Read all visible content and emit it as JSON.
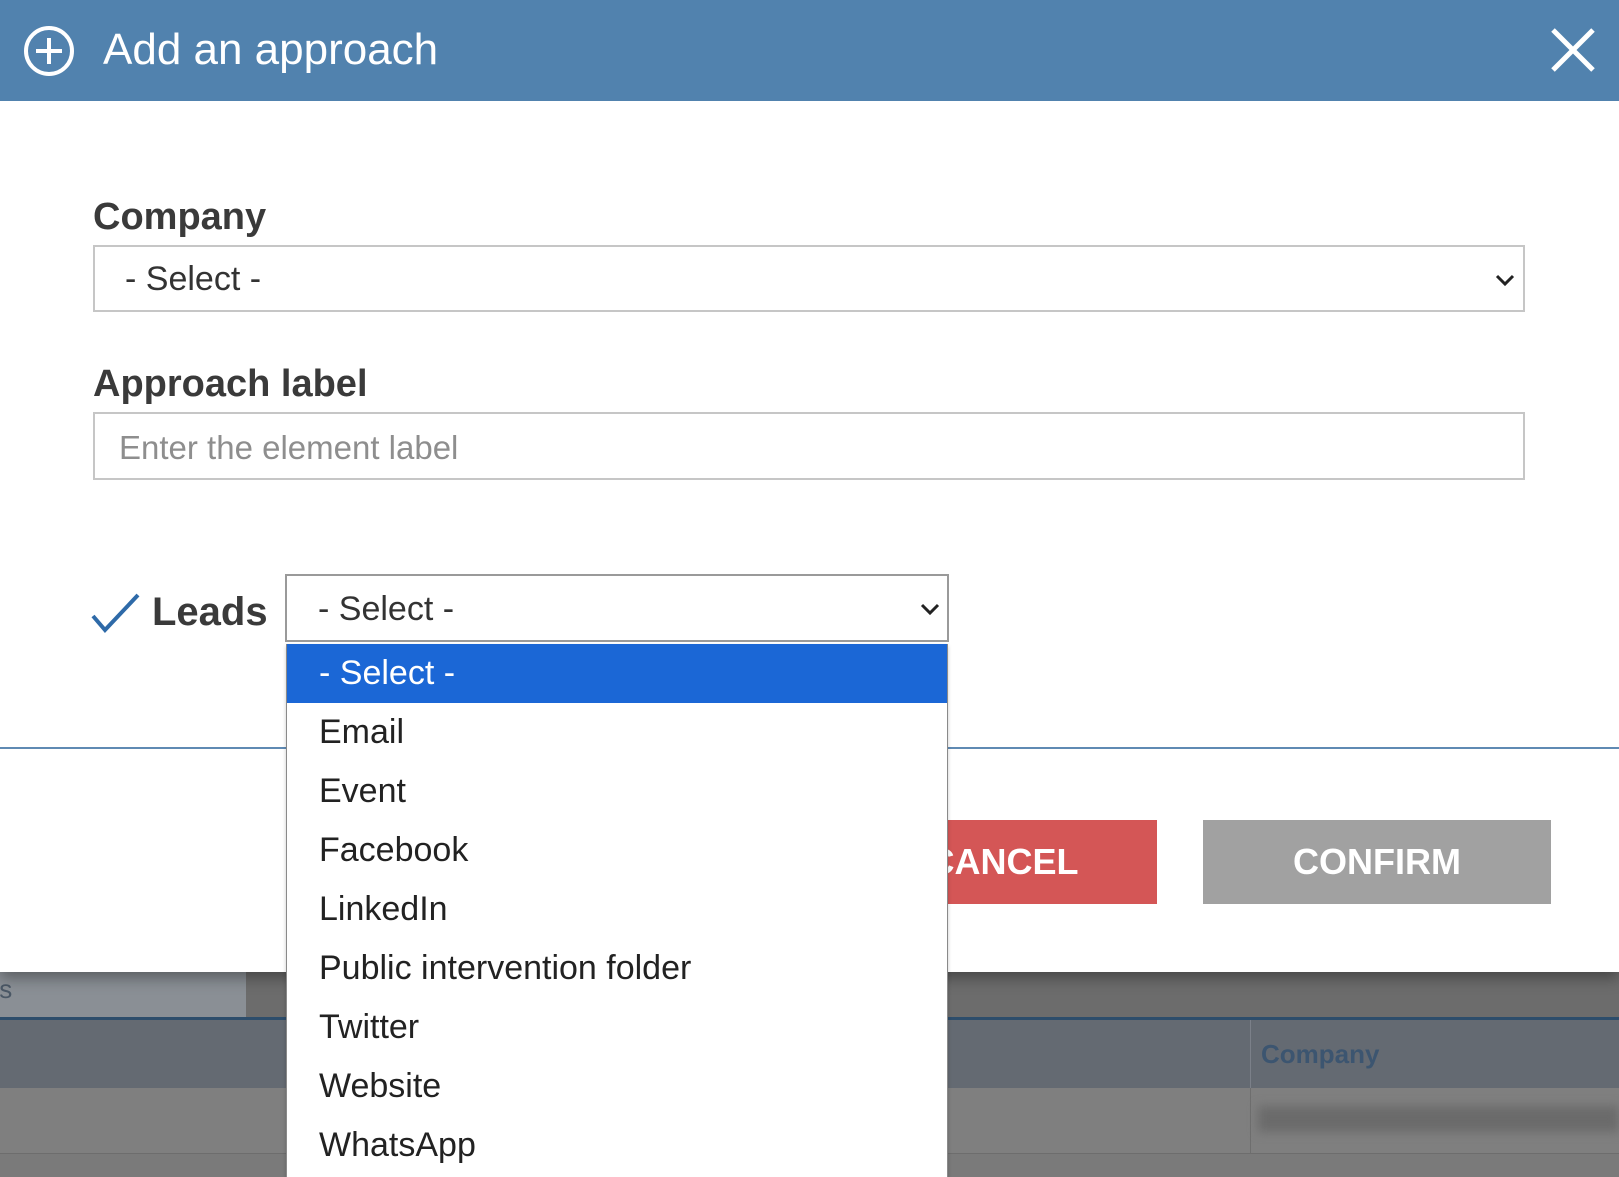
{
  "background": {
    "tab_fragment": "ts",
    "table_header": "Company"
  },
  "dialog": {
    "title": "Add an approach",
    "company_label": "Company",
    "company_value": "- Select -",
    "approach_label": "Approach label",
    "approach_placeholder": "Enter the element label",
    "leads_label": "Leads",
    "leads_value": "- Select -",
    "cancel_label": "CANCEL",
    "confirm_label": "CONFIRM"
  },
  "leads_options": [
    "- Select -",
    "Email",
    "Event",
    "Facebook",
    "LinkedIn",
    "Public intervention folder",
    "Twitter",
    "Website",
    "WhatsApp"
  ],
  "colors": {
    "header": "#5182ae",
    "cancel": "#d45656",
    "confirm": "#a1a1a1",
    "option_highlight": "#1b67d6",
    "check": "#2e6aa8"
  },
  "icons": {
    "header": "plus-circle-icon",
    "close": "close-icon",
    "check": "checkmark-icon",
    "select": "chevron-down-icon"
  }
}
